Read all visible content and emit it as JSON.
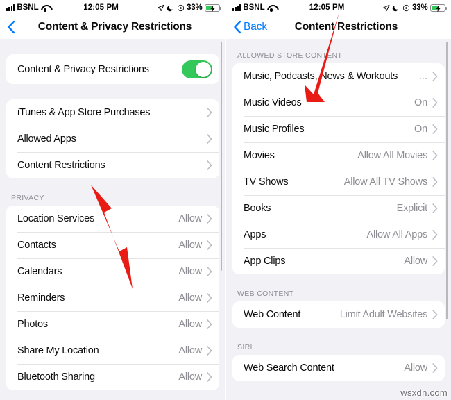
{
  "left": {
    "statusbar": {
      "carrier": "BSNL",
      "time": "12:05 PM",
      "battery_percent": "33%",
      "icons": [
        "signal-icon",
        "wifi-icon",
        "location-arrow-icon",
        "moon-icon",
        "alarm-icon",
        "battery-charging-icon"
      ]
    },
    "nav": {
      "back_label": "",
      "title": "Content & Privacy Restrictions"
    },
    "toggle_row": {
      "label": "Content & Privacy Restrictions",
      "state": "on"
    },
    "main_rows": [
      {
        "label": "iTunes & App Store Purchases",
        "value": ""
      },
      {
        "label": "Allowed Apps",
        "value": ""
      },
      {
        "label": "Content Restrictions",
        "value": ""
      }
    ],
    "privacy_header": "PRIVACY",
    "privacy_rows": [
      {
        "label": "Location Services",
        "value": "Allow"
      },
      {
        "label": "Contacts",
        "value": "Allow"
      },
      {
        "label": "Calendars",
        "value": "Allow"
      },
      {
        "label": "Reminders",
        "value": "Allow"
      },
      {
        "label": "Photos",
        "value": "Allow"
      },
      {
        "label": "Share My Location",
        "value": "Allow"
      },
      {
        "label": "Bluetooth Sharing",
        "value": "Allow"
      }
    ]
  },
  "right": {
    "statusbar": {
      "carrier": "BSNL",
      "time": "12:05 PM",
      "battery_percent": "33%"
    },
    "nav": {
      "back_label": "Back",
      "title": "Content Restrictions"
    },
    "store_header": "ALLOWED STORE CONTENT",
    "store_rows": [
      {
        "label": "Music, Podcasts, News & Workouts",
        "value": "",
        "ellipsis": "..."
      },
      {
        "label": "Music Videos",
        "value": "On"
      },
      {
        "label": "Music Profiles",
        "value": "On"
      },
      {
        "label": "Movies",
        "value": "Allow All Movies"
      },
      {
        "label": "TV Shows",
        "value": "Allow All TV Shows"
      },
      {
        "label": "Books",
        "value": "Explicit"
      },
      {
        "label": "Apps",
        "value": "Allow All Apps"
      },
      {
        "label": "App Clips",
        "value": "Allow"
      }
    ],
    "web_header": "WEB CONTENT",
    "web_rows": [
      {
        "label": "Web Content",
        "value": "Limit Adult Websites"
      }
    ],
    "siri_header": "SIRI",
    "siri_rows": [
      {
        "label": "Web Search Content",
        "value": "Allow"
      }
    ]
  },
  "annotations": {
    "arrow_color": "#e81b15",
    "watermark": "wsxdn.com"
  }
}
